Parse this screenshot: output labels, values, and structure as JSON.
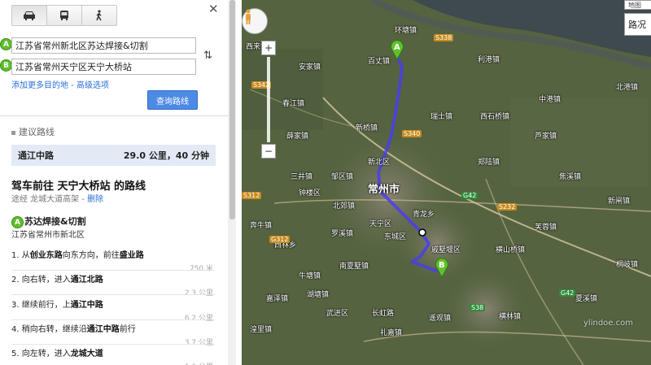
{
  "panel": {
    "modes": [
      {
        "icon": "car-icon"
      },
      {
        "icon": "bus-icon"
      },
      {
        "icon": "walk-icon"
      }
    ],
    "close_icon": "close-icon",
    "waypoint_a": {
      "marker": "A",
      "value": "江苏省常州新北区苏达焊接&切割"
    },
    "waypoint_b": {
      "marker": "B",
      "value": "江苏省常州天宁区天宁大桥站"
    },
    "add_destination": "添加更多目的地",
    "link_sep": " - ",
    "advanced_options": "高级选项",
    "search_button": "查询路线",
    "suggested_header": "建议路线",
    "route": {
      "name": "通江中路",
      "distance_time": "29.0 公里，40 分钟"
    },
    "directions_title": "驾车前往  天宁大桥站  的路线",
    "via_prefix": "途经 龙城大道高架 - ",
    "via_delete": "删除",
    "start_name": "苏达焊接&切割",
    "start_address": "江苏省常州市新北区",
    "steps": [
      {
        "num": "1.",
        "pre": "从",
        "road": "创业东路",
        "mid": "向东方向，前往",
        "road2": "盛业路",
        "dist": "750 米"
      },
      {
        "num": "2.",
        "pre": "向右转，进入",
        "road": "通江北路",
        "mid": "",
        "road2": "",
        "dist": "2.3 公里"
      },
      {
        "num": "3.",
        "pre": "继续前行，上",
        "road": "通江中路",
        "mid": "",
        "road2": "",
        "dist": "6.2 公里"
      },
      {
        "num": "4.",
        "pre": "稍向右转，继续沿",
        "road": "通江中路",
        "mid": "前行",
        "road2": "",
        "dist": "3.7 公里"
      },
      {
        "num": "5.",
        "pre": "向左转，进入",
        "road": "龙城大道",
        "mid": "",
        "road2": "",
        "dist": "1.6 公里"
      }
    ]
  },
  "map": {
    "traffic_label": "路况",
    "top_chip": "地图",
    "marker_a": "A",
    "marker_b": "B",
    "labels": {
      "l1": "环塘镇",
      "l2": "百丈镇",
      "l3": "安家镇",
      "l4": "利港镇",
      "l5": "西来镇",
      "l6": "薛家镇",
      "l7": "新桥镇",
      "l8": "瑞士镇",
      "l9": "西石桥镇",
      "l10": "中港镇",
      "l11": "新北区",
      "l12": "常州市",
      "l13": "郑陆镇",
      "l14": "焦溪镇",
      "l15": "钟楼区",
      "l16": "天宁区",
      "l17": "青龙乡",
      "l18": "东城区",
      "l19": "戚墅堰区",
      "l20": "西林乡",
      "l21": "湖塘镇",
      "l22": "牛塘镇",
      "l23": "武进区",
      "l24": "长虹路",
      "l25": "礼嘉镇",
      "l26": "湟里镇",
      "l27": "横林镇",
      "l28": "遥观镇",
      "l29": "横山桥镇",
      "l30": "芙蓉镇",
      "l31": "桐岐镇",
      "l32": "夏溪镇",
      "l33": "邹区镇",
      "l34": "春江镇",
      "l35": "三井镇",
      "l36": "奔牛镇",
      "l37": "罗溪镇",
      "l38": "北港镇",
      "l39": "南夏墅镇",
      "l40": "嘉泽镇",
      "l41": "芦家镇",
      "l42": "新闸镇",
      "l43": "北郊镇"
    },
    "shields": {
      "s1": "S338",
      "s2": "S340",
      "s3": "G42",
      "s4": "S232",
      "s5": "S38",
      "s6": "G42",
      "s7": "S312",
      "s8": "S342",
      "s9": "G312"
    },
    "watermark": "ylindoe.com",
    "icons": {
      "pegman": "pegman-icon",
      "zoom_in": "+",
      "zoom_out": "−"
    }
  }
}
